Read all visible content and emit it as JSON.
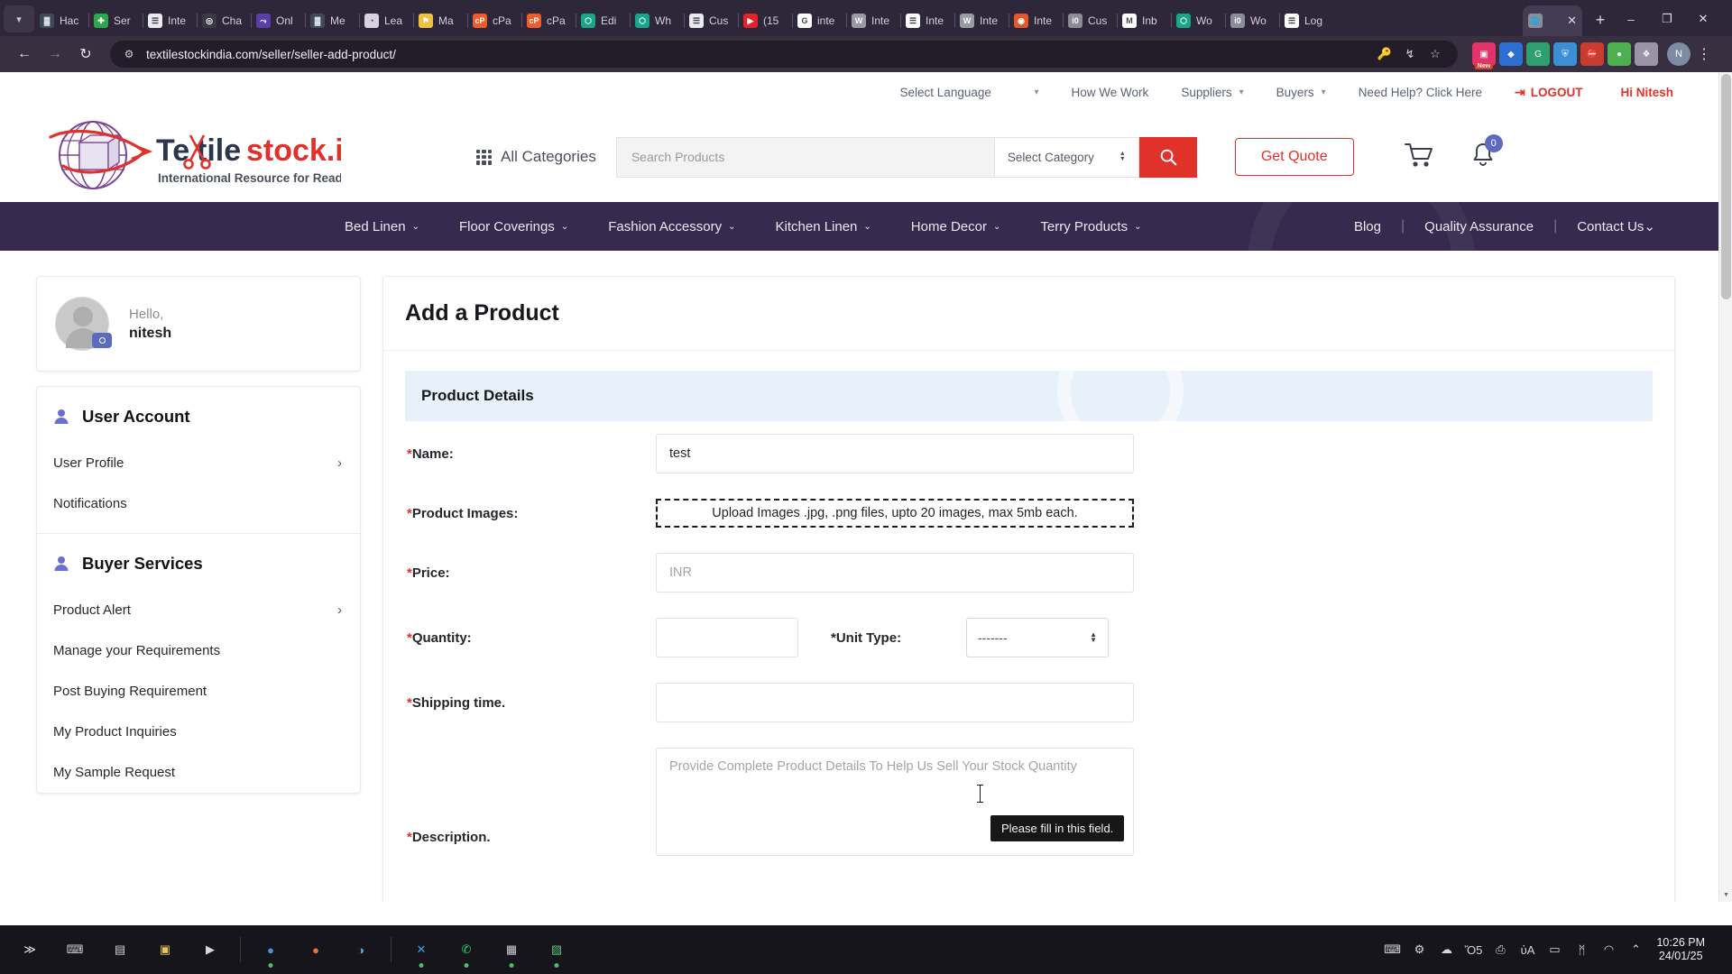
{
  "browser": {
    "tabs": [
      {
        "label": "Hac",
        "icon": "bar-chart-icon",
        "color": "#3e4a5a",
        "glyph": "▓"
      },
      {
        "label": "Ser",
        "icon": "green-cross-icon",
        "color": "#2aa84a",
        "glyph": "✚"
      },
      {
        "label": "Inte",
        "icon": "document-icon",
        "color": "#e9e9ef",
        "glyph": "☰"
      },
      {
        "label": "Cha",
        "icon": "fingerprint-icon",
        "color": "#3a3a46",
        "glyph": "◎"
      },
      {
        "label": "Onl",
        "icon": "purple-bolt-icon",
        "color": "#5b3fa8",
        "glyph": "⤳"
      },
      {
        "label": "Me",
        "icon": "bar-chart-icon",
        "color": "#3e4a5a",
        "glyph": "▓"
      },
      {
        "label": "Lea",
        "icon": "palette-icon",
        "color": "#d8d2e2",
        "glyph": "◔"
      },
      {
        "label": "Ma",
        "icon": "yellow-pin-icon",
        "color": "#f0c040",
        "glyph": "⚑"
      },
      {
        "label": "cPa",
        "icon": "cpanel-icon",
        "color": "#ef5c29",
        "glyph": "cP"
      },
      {
        "label": "cPa",
        "icon": "cpanel-icon",
        "color": "#ef5c29",
        "glyph": "cP"
      },
      {
        "label": "Edi",
        "icon": "elementor-icon",
        "color": "#18a58a",
        "glyph": "⬡"
      },
      {
        "label": "Wh",
        "icon": "elementor-icon",
        "color": "#18a58a",
        "glyph": "⬡"
      },
      {
        "label": "Cus",
        "icon": "document-icon",
        "color": "#e9e9ef",
        "glyph": "☰"
      },
      {
        "label": "(15",
        "icon": "youtube-icon",
        "color": "#e2232a",
        "glyph": "▶"
      },
      {
        "label": "inte",
        "icon": "google-icon",
        "color": "#ffffff",
        "glyph": "G"
      },
      {
        "label": "Inte",
        "icon": "wordpress-icon",
        "color": "#9a9aa6",
        "glyph": "W"
      },
      {
        "label": "Inte",
        "icon": "document-icon",
        "color": "#ffffff",
        "glyph": "☰"
      },
      {
        "label": "Inte",
        "icon": "wordpress-icon",
        "color": "#9a9aa6",
        "glyph": "W"
      },
      {
        "label": "Inte",
        "icon": "orange-app-icon",
        "color": "#e2562a",
        "glyph": "◉"
      },
      {
        "label": "Cus",
        "icon": "globe-icon",
        "color": "#8c8c99",
        "glyph": "ἱ0"
      },
      {
        "label": "Inb",
        "icon": "gmail-icon",
        "color": "#ffffff",
        "glyph": "M"
      },
      {
        "label": "Wo",
        "icon": "elementor-icon",
        "color": "#18a58a",
        "glyph": "⬡"
      },
      {
        "label": "Wo",
        "icon": "globe-icon",
        "color": "#8c8c99",
        "glyph": "ἱ0"
      },
      {
        "label": "Log",
        "icon": "document-icon",
        "color": "#ffffff",
        "glyph": "☰"
      }
    ],
    "active_tab": {
      "label": "",
      "icon": "globe-icon",
      "close_label": "✕"
    },
    "new_tab_label": "+",
    "window_controls": {
      "minimize": "–",
      "maximize": "❐",
      "close": "✕"
    },
    "nav": {
      "back": "←",
      "forward": "→",
      "reload": "↻"
    },
    "url": "textilestockindia.com/seller/seller-add-product/",
    "omnibox_icons": [
      "password-key-icon",
      "install-app-icon",
      "bookmark-star-icon"
    ],
    "extensions": [
      {
        "name": "instagram-extension-icon",
        "color": "#e2336b",
        "glyph": "▣",
        "badge": "New"
      },
      {
        "name": "blue-extension-icon",
        "color": "#2d6fd1",
        "glyph": "◆",
        "badge": ""
      },
      {
        "name": "grammarly-extension-icon",
        "color": "#2f9f6f",
        "glyph": "G",
        "badge": ""
      },
      {
        "name": "shield-extension-icon",
        "color": "#3d8fd4",
        "glyph": "⛨",
        "badge": ""
      },
      {
        "name": "adblock-extension-icon",
        "color": "#c93c30",
        "glyph": "⛔",
        "badge": ""
      },
      {
        "name": "green-extension-icon",
        "color": "#4caf50",
        "glyph": "●",
        "badge": ""
      },
      {
        "name": "puzzle-extension-icon",
        "color": "#9a94a8",
        "glyph": "❖",
        "badge": ""
      }
    ],
    "profile_initial": "N",
    "menu_button": "⋮"
  },
  "site": {
    "utility_nav": {
      "select_language": "Select Language",
      "items": [
        {
          "label": "How We Work",
          "has_caret": false
        },
        {
          "label": "Suppliers",
          "has_caret": true
        },
        {
          "label": "Buyers",
          "has_caret": true
        },
        {
          "label": "Need Help? Click Here",
          "has_caret": false
        }
      ],
      "logout": "LOGOUT",
      "greeting": "Hi Nitesh"
    },
    "logo": {
      "text_part1": "Te",
      "text_part2": "tile",
      "text_part3": "stock.in",
      "tagline": "International Resource for Ready Goods",
      "dark_color": "#2b3550",
      "red_color": "#e0312a",
      "purple_color": "#7b4397"
    },
    "all_categories": "All Categories",
    "search": {
      "placeholder": "Search Products",
      "category_placeholder": "Select Category",
      "button_icon": "search-icon"
    },
    "get_quote": "Get Quote",
    "cart_icon": "cart-icon",
    "notification_icon": "bell-icon",
    "notification_count": "0",
    "main_nav": {
      "left": [
        {
          "label": "Bed Linen",
          "has_caret": true
        },
        {
          "label": "Floor Coverings",
          "has_caret": true
        },
        {
          "label": "Fashion Accessory",
          "has_caret": true
        },
        {
          "label": "Kitchen Linen",
          "has_caret": true
        },
        {
          "label": "Home Decor",
          "has_caret": true
        },
        {
          "label": "Terry Products",
          "has_caret": true
        }
      ],
      "right": [
        {
          "label": "Blog",
          "has_caret": false
        },
        {
          "label": "Quality Assurance",
          "has_caret": false
        },
        {
          "label": "Contact Us",
          "has_caret": true
        }
      ]
    }
  },
  "sidebar": {
    "profile": {
      "hello": "Hello,",
      "username": "nitesh",
      "camera_icon": "camera-icon"
    },
    "sections": [
      {
        "title": "User Account",
        "icon": "user-icon",
        "items": [
          {
            "label": "User Profile",
            "has_chevron": true
          },
          {
            "label": "Notifications",
            "has_chevron": false
          }
        ]
      },
      {
        "title": "Buyer Services",
        "icon": "user-icon",
        "items": [
          {
            "label": "Product Alert",
            "has_chevron": true
          },
          {
            "label": "Manage your Requirements",
            "has_chevron": false
          },
          {
            "label": "Post Buying Requirement",
            "has_chevron": false
          },
          {
            "label": "My Product Inquiries",
            "has_chevron": false
          },
          {
            "label": "My Sample Request",
            "has_chevron": false
          }
        ]
      }
    ]
  },
  "main": {
    "page_title": "Add a Product",
    "section_title": "Product Details",
    "fields": {
      "name": {
        "label": "*Name:",
        "value": "test"
      },
      "product_images": {
        "label": "*Product Images:",
        "upload_text": "Upload Images .jpg, .png files, upto 20 images, max 5mb each."
      },
      "price": {
        "label": "*Price:",
        "placeholder": "INR",
        "value": ""
      },
      "quantity": {
        "label": "*Quantity:",
        "value": ""
      },
      "unit_type": {
        "label": "*Unit Type:",
        "selected": "-------"
      },
      "shipping_time": {
        "label": "*Shipping time.",
        "value": ""
      },
      "description": {
        "label": "*Description.",
        "placeholder": "Provide Complete Product Details To Help Us Sell Your Stock Quantity",
        "value": ""
      }
    },
    "validation_tooltip": "Please fill in this field.",
    "chat_widget_icon": "chat-support-icon"
  },
  "taskbar": {
    "items": [
      {
        "name": "start-button",
        "glyph": "≫",
        "color": "#f0ecf7",
        "running": false
      },
      {
        "name": "search-taskbar",
        "glyph": "⌨",
        "color": "#cfc9d9",
        "running": false
      },
      {
        "name": "app-folder",
        "glyph": "▤",
        "color": "#d0ccd8",
        "running": false
      },
      {
        "name": "file-manager",
        "glyph": "▣",
        "color": "#e8c45c",
        "running": false
      },
      {
        "name": "terminal",
        "glyph": "▶",
        "color": "#d8d4e0",
        "running": false
      },
      {
        "name": "chrome-browser",
        "glyph": "●",
        "color": "#4a90d9",
        "running": true
      },
      {
        "name": "firefox-browser",
        "glyph": "●",
        "color": "#e8762c",
        "running": false
      },
      {
        "name": "paint-app",
        "glyph": "◑",
        "color": "#5aa8e0",
        "running": false
      },
      {
        "name": "vscode-app",
        "glyph": "✕",
        "color": "#3c9fe0",
        "running": true
      },
      {
        "name": "whatsapp-app",
        "glyph": "✆",
        "color": "#25d366",
        "running": true
      },
      {
        "name": "notes-app",
        "glyph": "▦",
        "color": "#cfcada",
        "running": true
      },
      {
        "name": "gallery-app",
        "glyph": "▨",
        "color": "#5ac07a",
        "running": true
      }
    ],
    "tray_icons": [
      "keyboard-icon",
      "settings-icon",
      "cloud-icon",
      "calendar-icon",
      "printer-icon",
      "volume-icon",
      "battery-icon",
      "bluetooth-icon",
      "wifi-icon",
      "chevron-up-icon"
    ],
    "time": "10:26 PM",
    "date": "24/01/25"
  }
}
